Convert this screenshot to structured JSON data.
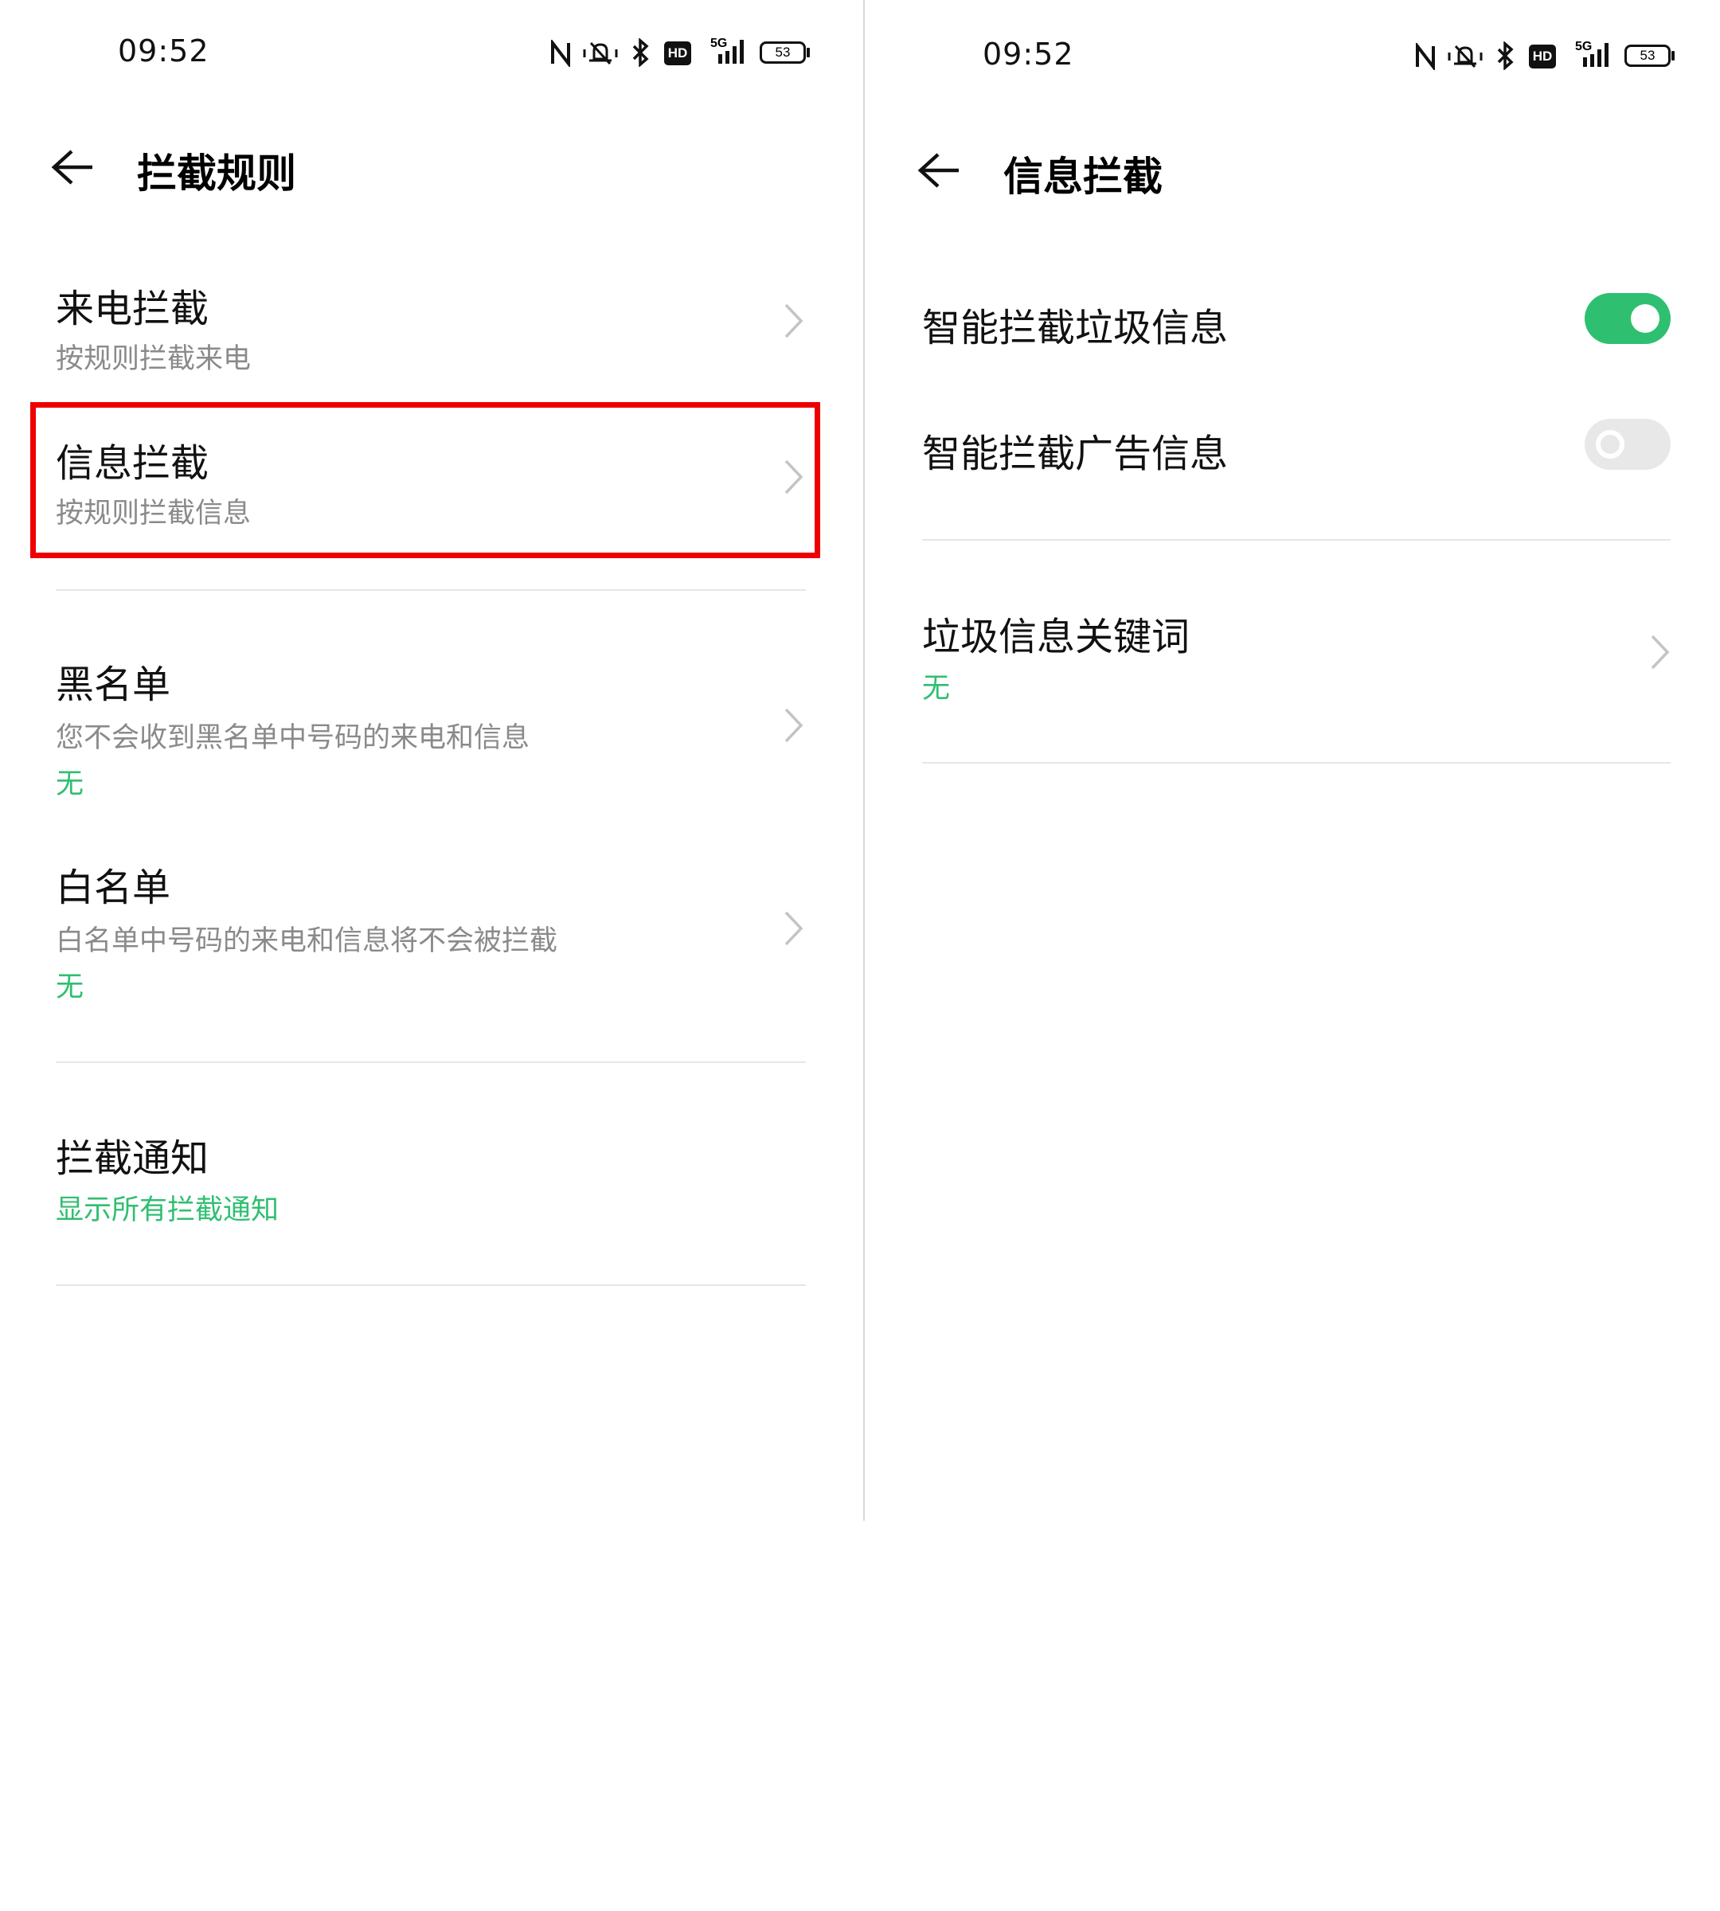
{
  "colors": {
    "accent_green": "#2fbf71",
    "toggle_off": "#e8e8e8",
    "highlight_red": "#ee0000",
    "subtitle_gray": "#8a8a8a"
  },
  "left_screen": {
    "status_bar": {
      "time": "09:52",
      "battery": "53",
      "network": "5G",
      "hd": "HD",
      "icons": [
        "nfc-icon",
        "vibrate-icon",
        "bluetooth-icon",
        "hd-icon",
        "signal-5g-icon",
        "battery-icon"
      ]
    },
    "header": {
      "back_icon": "back-arrow-icon",
      "title": "拦截规则"
    },
    "items": [
      {
        "title": "来电拦截",
        "subtitle": "按规则拦截来电"
      },
      {
        "title": "信息拦截",
        "subtitle": "按规则拦截信息"
      },
      {
        "title": "黑名单",
        "subtitle": "您不会收到黑名单中号码的来电和信息",
        "value": "无"
      },
      {
        "title": "白名单",
        "subtitle": "白名单中号码的来电和信息将不会被拦截",
        "value": "无"
      },
      {
        "title": "拦截通知",
        "value": "显示所有拦截通知"
      }
    ]
  },
  "right_screen": {
    "status_bar": {
      "time": "09:52",
      "battery": "53",
      "network": "5G",
      "hd": "HD",
      "icons": [
        "nfc-icon",
        "vibrate-icon",
        "bluetooth-icon",
        "hd-icon",
        "signal-5g-icon",
        "battery-icon"
      ]
    },
    "header": {
      "back_icon": "back-arrow-icon",
      "title": "信息拦截"
    },
    "toggles": [
      {
        "label": "智能拦截垃圾信息",
        "state": "on"
      },
      {
        "label": "智能拦截广告信息",
        "state": "off"
      }
    ],
    "keyword_item": {
      "title": "垃圾信息关键词",
      "value": "无"
    }
  }
}
